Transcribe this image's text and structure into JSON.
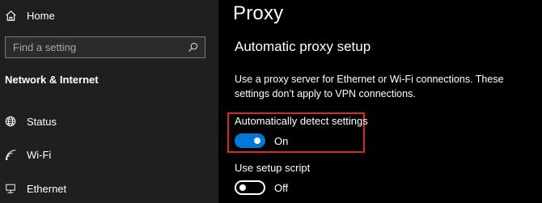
{
  "sidebar": {
    "home_label": "Home",
    "search_placeholder": "Find a setting",
    "section_title": "Network & Internet",
    "items": [
      {
        "label": "Status",
        "icon": "globe-icon"
      },
      {
        "label": "Wi-Fi",
        "icon": "wifi-icon"
      },
      {
        "label": "Ethernet",
        "icon": "ethernet-icon"
      }
    ]
  },
  "main": {
    "title": "Proxy",
    "heading": "Automatic proxy setup",
    "description": "Use a proxy server for Ethernet or Wi-Fi connections. These settings don’t apply to VPN connections.",
    "auto_detect": {
      "label": "Automatically detect settings",
      "state_label": "On",
      "value": true
    },
    "setup_script": {
      "label": "Use setup script",
      "state_label": "Off",
      "value": false
    }
  },
  "colors": {
    "accent": "#0078d7",
    "highlight_border": "#e02424",
    "sidebar_bg": "#1f1f1f",
    "main_bg": "#000000"
  }
}
